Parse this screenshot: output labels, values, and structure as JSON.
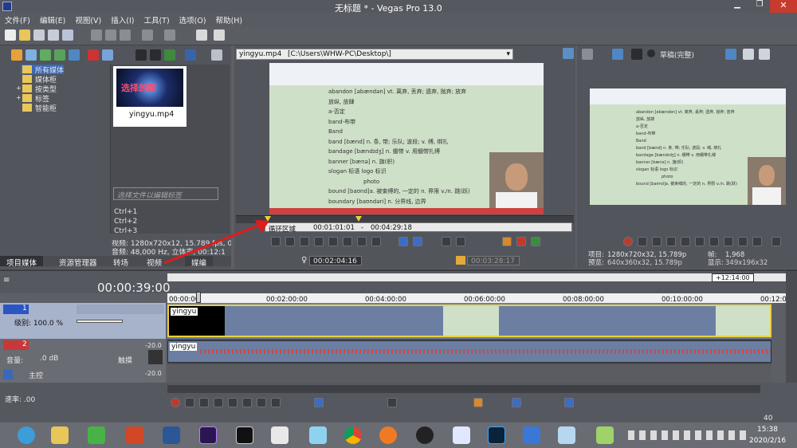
{
  "window": {
    "title": "无标题 * - Vegas Pro 13.0"
  },
  "menu": [
    "文件(F)",
    "编辑(E)",
    "视图(V)",
    "插入(I)",
    "工具(T)",
    "选项(O)",
    "帮助(H)"
  ],
  "explorer": {
    "tree": [
      "所有媒体",
      "媒体柜",
      "按类型",
      "标签",
      "智能柜"
    ],
    "media_name": "yingyu.mp4",
    "media_thumb_text": "选择的题",
    "tag_placeholder": "选择文件以编辑标签",
    "shortcuts": [
      "Ctrl+1",
      "Ctrl+2",
      "Ctrl+3"
    ],
    "info": [
      "视频: 1280x720x12, 15.789 fps, 0",
      "音频: 48,000 Hz, 立体声, 00:12:1"
    ],
    "tabs": [
      "项目媒体",
      "资源管理器",
      "转场",
      "视频",
      "媒编"
    ]
  },
  "trimmer": {
    "file": "yingyu.mp4",
    "path": "[C:\\Users\\WHW-PC\\Desktop\\]",
    "loop_label": "循环区域",
    "loop_start": "00:01:01:01",
    "loop_end": "00:04:29:18",
    "pos": "00:02:04:16",
    "len": "00:03:28:17"
  },
  "preview": {
    "quality": "草稿(完整)",
    "project_label": "项目:",
    "project_value": "1280x720x32, 15.789p",
    "frame_label": "帧:",
    "frame_value": "1,968",
    "preview_label": "预览:",
    "preview_value": "640x360x32, 15.789p",
    "display_label": "显示:",
    "display_value": "349x196x32"
  },
  "doc_lines": [
    "abandon [əbændən]   vt. 离弃, 丢弃; 遗弃, 抛弃; 放弃",
    "放纵, 放肆",
    "a-否定",
    "band-布带",
    "Band",
    "band [bænd]    n. 条, 带; 乐队; 波段; v. 缚, 绑扎",
    "bandage [bændɪdʒ]   n. 绷带 v. 用绷带扎缚",
    "banner  [bænə]    n. 旗(帜)",
    "slogan  标语  logo  标识",
    "photo",
    "bound  [baʊnd]a. 被束缚的, 一定的  n. 界限 v./n. 跳(跃)",
    "boundary [baʊndəri]   n. 分界线, 边界"
  ],
  "timeline": {
    "time": "00:00:39:00",
    "marker": "+12:14:00",
    "ruler": [
      "00:00:00",
      "00:02:00:00",
      "00:04:00:00",
      "00:06:00:00",
      "00:08:00:00",
      "00:10:00:00",
      "00:12:00"
    ],
    "track1": {
      "num": "1",
      "level_label": "级别: 100.0 %",
      "clip": "yingyu"
    },
    "track2": {
      "num": "2",
      "vol_label": "音量:",
      "vol_value": ".0 dB",
      "pan_label": "触摸",
      "db_a": "-20.0",
      "db_b": "-20.0",
      "clip": "yingyu"
    },
    "master": {
      "label": "主控",
      "db_a": "-20.0",
      "db_b": "-20.0"
    },
    "rate": "速率: .00",
    "bottom_time": "40"
  },
  "taskbar": {
    "clock": "15:38",
    "date": "2020/2/16"
  },
  "colors": {
    "app_bg": "#5d5f66",
    "panel_dark": "#3e4046",
    "timeline_bar": "#f0f0f0",
    "video_track": "#6c7fa3",
    "audio_wave": "#c94a4a",
    "arrow": "#e31b1b",
    "taskbar": "#6a6c73"
  }
}
